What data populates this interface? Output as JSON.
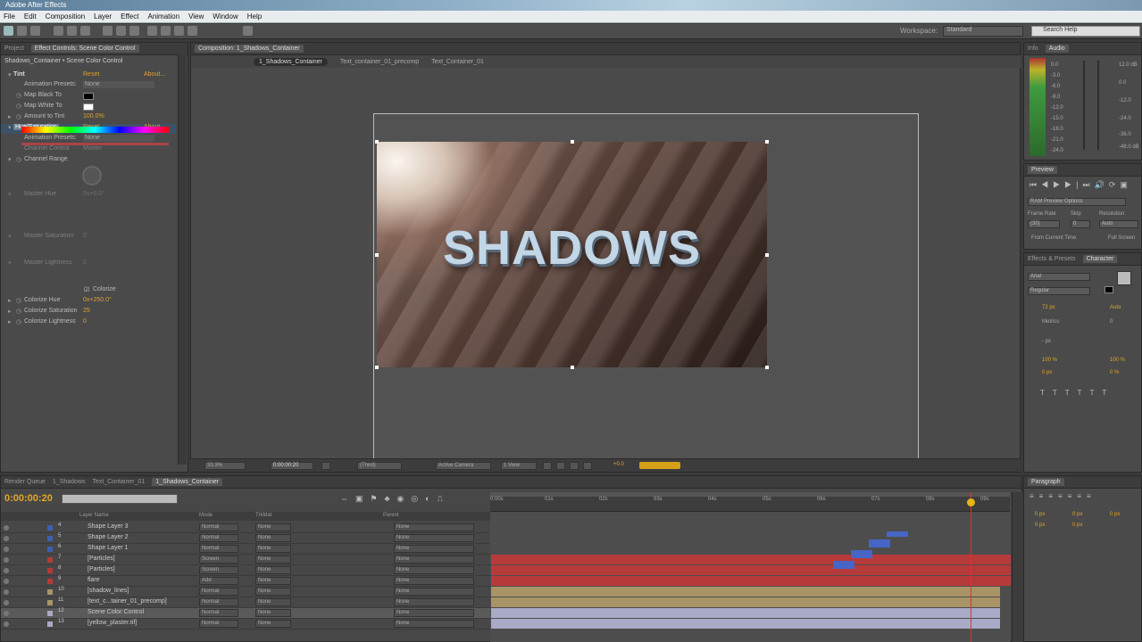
{
  "window": {
    "title": "Adobe After Effects"
  },
  "menu": [
    "File",
    "Edit",
    "Composition",
    "Layer",
    "Effect",
    "Animation",
    "View",
    "Window",
    "Help"
  ],
  "toolbar": {
    "workspace_label": "Workspace:",
    "workspace_value": "Standard",
    "help_search": "Search Help"
  },
  "effect_controls": {
    "tabs": [
      "Project",
      "Effect Controls: Scene Color Control"
    ],
    "header": "Shadows_Container • Scene Color Control",
    "rows": [
      {
        "label": "Tint",
        "value": "Reset",
        "extra": "About..."
      },
      {
        "label": "Animation Presets:",
        "value": "None"
      },
      {
        "label": "Map Black To",
        "value": ""
      },
      {
        "label": "Map White To",
        "value": ""
      },
      {
        "label": "Amount to Tint",
        "value": "100.0%"
      },
      {
        "label": "Hue/Saturation",
        "value": "Reset",
        "extra": "About..."
      },
      {
        "label": "Animation Presets:",
        "value": "None"
      },
      {
        "label": "Channel Control",
        "value": "Master"
      },
      {
        "label": "Channel Range",
        "value": ""
      },
      {
        "label": "Master Hue",
        "value": "0x+0.0°"
      },
      {
        "label": "Master Saturation",
        "value": "0"
      },
      {
        "label": "Master Lightness",
        "value": "0"
      },
      {
        "label": "Colorize",
        "value": ""
      },
      {
        "label": "Colorize Hue",
        "value": "0x+250.0°"
      },
      {
        "label": "Colorize Saturation",
        "value": "25"
      },
      {
        "label": "Colorize Lightness",
        "value": "0"
      }
    ]
  },
  "composition": {
    "tab": "Composition: 1_Shadows_Container",
    "breadcrumbs": [
      "1_Shadows_Container",
      "Text_container_01_precomp",
      "Text_Container_01"
    ],
    "title_text": "SHADOWS",
    "viewer_controls": {
      "zoom": "33.3%",
      "timecode": "0:00:00:20",
      "res": "(Third)",
      "camera": "Active Camera",
      "views": "1 View",
      "exposure": "+0.0"
    }
  },
  "info_panel": {
    "tabs": [
      "Info",
      "Audio"
    ],
    "db_values": [
      "0.0",
      "-3.0",
      "-6.0",
      "-9.0",
      "-12.0",
      "-15.0",
      "-18.0",
      "-21.0",
      "-24.0"
    ],
    "right_values": [
      "12.0 dB",
      "0.0",
      "-12.0",
      "-24.0",
      "-36.0",
      "-48.0 dB"
    ]
  },
  "preview_panel": {
    "title": "Preview",
    "ram_preview": "RAM Preview Options",
    "frame_rate_label": "Frame Rate",
    "skip_label": "Skip",
    "resolution_label": "Resolution",
    "frame_rate": "(30)",
    "skip": "0",
    "resolution": "Auto",
    "from_current": "From Current Time",
    "full_screen": "Full Screen"
  },
  "character_panel": {
    "tabs": [
      "Effects & Presets",
      "Character"
    ],
    "font": "Arial",
    "style": "Regular",
    "size": "72 px",
    "leading": "Auto",
    "kerning": "Metrics",
    "tracking": "0",
    "stroke": "- px",
    "vscale": "100 %",
    "hscale": "100 %",
    "baseline": "0 px",
    "tsume": "0 %"
  },
  "paragraph_panel": {
    "title": "Paragraph",
    "v1": "0 px",
    "v2": "0 px",
    "v3": "0 px",
    "v4": "0 px",
    "v5": "0 px"
  },
  "timeline": {
    "tabs": [
      "Render Queue",
      "1_Shadows",
      "Text_Container_01",
      "1_Shadows_Container"
    ],
    "timecode": "0:00:00:20",
    "columns": {
      "layer": "Layer Name",
      "mode": "Mode",
      "trkmat": "TrkMat",
      "parent": "Parent"
    },
    "ruler": [
      "0:00s",
      "01s",
      "02s",
      "03s",
      "04s",
      "05s",
      "06s",
      "07s",
      "08s",
      "09s"
    ],
    "layers": [
      {
        "num": "4",
        "name": "Shape Layer 3",
        "mode": "Normal",
        "trk": "None",
        "parent": "None",
        "color": "#3e5fb0"
      },
      {
        "num": "5",
        "name": "Shape Layer 2",
        "mode": "Normal",
        "trk": "None",
        "parent": "None",
        "color": "#3e5fb0"
      },
      {
        "num": "6",
        "name": "Shape Layer 1",
        "mode": "Normal",
        "trk": "None",
        "parent": "None",
        "color": "#3e5fb0"
      },
      {
        "num": "7",
        "name": "[Particles]",
        "mode": "Screen",
        "trk": "None",
        "parent": "None",
        "color": "#b73a3a"
      },
      {
        "num": "8",
        "name": "[Particles]",
        "mode": "Screen",
        "trk": "None",
        "parent": "None",
        "color": "#b73a3a"
      },
      {
        "num": "9",
        "name": "flare",
        "mode": "Add",
        "trk": "None",
        "parent": "None",
        "color": "#b73a3a"
      },
      {
        "num": "10",
        "name": "[shadow_lines]",
        "mode": "Normal",
        "trk": "None",
        "parent": "None",
        "color": "#a89466"
      },
      {
        "num": "11",
        "name": "[text_c...tainer_01_precomp]",
        "mode": "Normal",
        "trk": "None",
        "parent": "None",
        "color": "#a89466"
      },
      {
        "num": "12",
        "name": "Scene Color Control",
        "mode": "Normal",
        "trk": "None",
        "parent": "None",
        "color": "#a9a9c8"
      },
      {
        "num": "13",
        "name": "[yellow_plaster.tif]",
        "mode": "Normal",
        "trk": "None",
        "parent": "None",
        "color": "#a9a9c8"
      }
    ]
  },
  "colors": {
    "accent": "#e4a52a",
    "playhead": "#e03030",
    "red_bar": "#c73a3a",
    "tan_bar": "#a89466",
    "lav_bar": "#a9a9c8"
  }
}
